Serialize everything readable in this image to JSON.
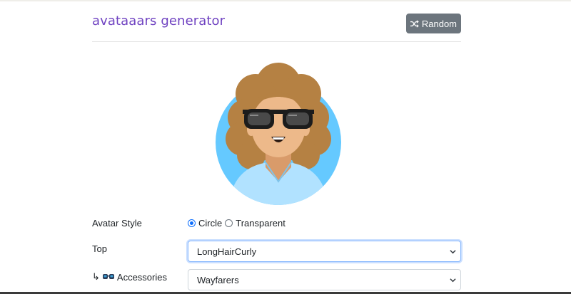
{
  "app": {
    "title": "avataaars generator",
    "random_button_label": "Random"
  },
  "form": {
    "avatar_style": {
      "label": "Avatar Style",
      "options": [
        {
          "label": "Circle",
          "checked": true
        },
        {
          "label": "Transparent",
          "checked": false
        }
      ]
    },
    "top": {
      "label": "Top",
      "value": "LongHairCurly"
    },
    "accessories": {
      "prefix": "↳",
      "icon": "sunglasses-icon",
      "label": "Accessories",
      "value": "Wayfarers"
    }
  },
  "colors": {
    "accent": "#6f42c1",
    "button": "#6c757d",
    "avatar_background": "#65c9ff",
    "hair": "#b58143",
    "skin": "#edb98a",
    "shirt": "#b1e2ff"
  }
}
